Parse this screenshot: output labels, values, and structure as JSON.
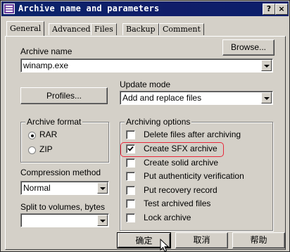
{
  "window": {
    "title": "Archive name and parameters",
    "help_button": "?",
    "close_button": "×"
  },
  "tabs": [
    {
      "label": "General",
      "active": true
    },
    {
      "label": "Advanced",
      "active": false
    },
    {
      "label": "Files",
      "active": false
    },
    {
      "label": "Backup",
      "active": false
    },
    {
      "label": "Comment",
      "active": false
    }
  ],
  "archive_name": {
    "label": "Archive name",
    "browse_label": "Browse...",
    "value": "winamp.exe"
  },
  "profiles_label": "Profiles...",
  "update_mode": {
    "label": "Update mode",
    "value": "Add and replace files"
  },
  "archive_format": {
    "title": "Archive format",
    "options": [
      {
        "label": "RAR",
        "selected": true
      },
      {
        "label": "ZIP",
        "selected": false
      }
    ]
  },
  "compression": {
    "label": "Compression method",
    "value": "Normal"
  },
  "split": {
    "label": "Split to volumes, bytes",
    "value": ""
  },
  "archiving_options": {
    "title": "Archiving options",
    "items": [
      {
        "label": "Delete files after archiving",
        "checked": false
      },
      {
        "label": "Create SFX archive",
        "checked": true
      },
      {
        "label": "Create solid archive",
        "checked": false
      },
      {
        "label": "Put authenticity verification",
        "checked": false
      },
      {
        "label": "Put recovery record",
        "checked": false
      },
      {
        "label": "Test archived files",
        "checked": false
      },
      {
        "label": "Lock archive",
        "checked": false
      }
    ]
  },
  "footer": {
    "ok_label": "确定",
    "cancel_label": "取消",
    "help_label": "帮助"
  },
  "colors": {
    "titlebar": "#0a246a",
    "face": "#d4d0c8",
    "highlight_outline": "#e8273a"
  }
}
